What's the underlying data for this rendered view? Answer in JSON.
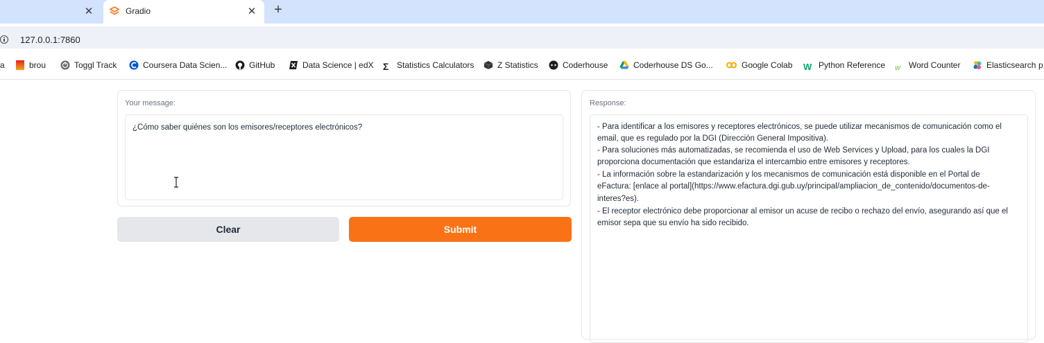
{
  "browser": {
    "active_tab_title": "Gradio",
    "url": "127.0.0.1:7860",
    "bookmarks": [
      {
        "label": "a",
        "icon": "bookmark-fragment"
      },
      {
        "label": "brou",
        "icon": "brou-logo-icon"
      },
      {
        "label": "Toggl Track",
        "icon": "toggl-icon"
      },
      {
        "label": "Coursera Data Scien...",
        "icon": "coursera-icon"
      },
      {
        "label": "GitHub",
        "icon": "github-icon"
      },
      {
        "label": "Data Science | edX",
        "icon": "edx-icon"
      },
      {
        "label": "Statistics Calculators",
        "icon": "sigma-icon"
      },
      {
        "label": "Z Statistics",
        "icon": "cube-icon"
      },
      {
        "label": "Coderhouse",
        "icon": "coderhouse-icon"
      },
      {
        "label": "Coderhouse DS Go...",
        "icon": "google-drive-icon"
      },
      {
        "label": "Google Colab",
        "icon": "colab-icon"
      },
      {
        "label": "Python Reference",
        "icon": "w3schools-icon"
      },
      {
        "label": "Word Counter",
        "icon": "word-counter-icon"
      },
      {
        "label": "Elasticsearch",
        "icon": "elasticsearch-icon"
      },
      {
        "label": "p",
        "icon": "bookmark-fragment"
      }
    ]
  },
  "app": {
    "input_label": "Your message:",
    "input_value": "¿Cómo saber quiénes son los emisores/receptores electrónicos?",
    "clear_label": "Clear",
    "submit_label": "Submit",
    "output_label": "Response:",
    "response_lines": [
      "- Para identificar a los emisores y receptores electrónicos, se puede utilizar mecanismos de comunicación como el",
      "email, que es regulado por la DGI (Dirección General Impositiva).",
      "- Para soluciones más automatizadas, se recomienda el uso de Web Services y Upload, para los cuales la DGI",
      "proporciona documentación que estandariza el intercambio entre emisores y receptores.",
      "- La información sobre la estandarización y los mecanismos de comunicación está disponible en el Portal de",
      "eFactura: [enlace al portal](https://www.efactura.dgi.gub.uy/principal/ampliacion_de_contenido/documentos-de-",
      "interes?es).",
      "- El receptor electrónico debe proporcionar al emisor un acuse de recibo o rechazo del envío, asegurando así que el",
      "emisor sepa que su envío ha sido recibido."
    ]
  },
  "colors": {
    "submit": "#f97316",
    "clear": "#e5e7eb",
    "tabbar": "#d3e3fd"
  }
}
